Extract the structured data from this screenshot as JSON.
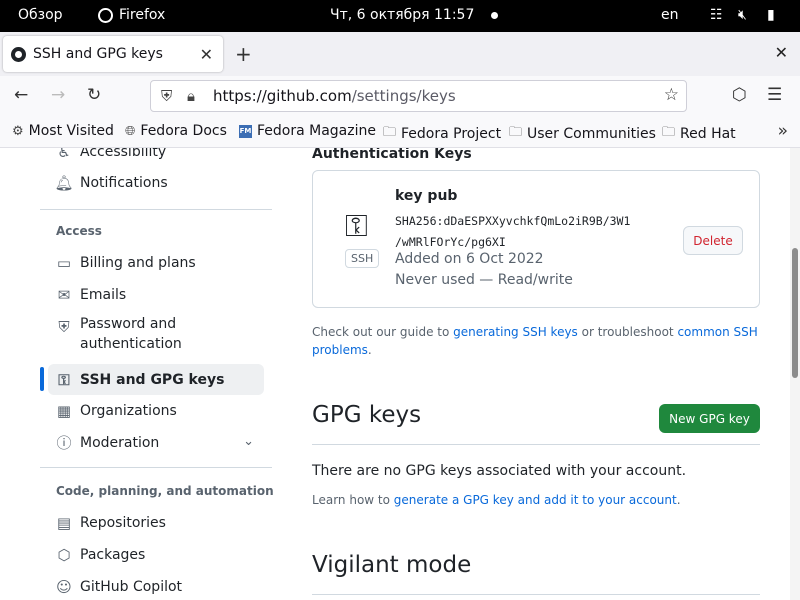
{
  "topbar": {
    "activities": "Обзор",
    "app_name": "Firefox",
    "clock": "Чт, 6 октября  11:57",
    "lang": "en"
  },
  "browser": {
    "tab_title": "SSH and GPG keys",
    "url_host": "https://github.com",
    "url_path": "/settings/keys",
    "bookmarks": [
      "Most Visited",
      "Fedora Docs",
      "Fedora Magazine",
      "Fedora Project",
      "User Communities",
      "Red Hat"
    ]
  },
  "sidebar": {
    "items_top": [
      {
        "label": "Accessibility",
        "icon": "accessibility-icon"
      },
      {
        "label": "Notifications",
        "icon": "bell-icon"
      }
    ],
    "access_heading": "Access",
    "access_items": [
      {
        "label": "Billing and plans",
        "icon": "credit-card-icon"
      },
      {
        "label": "Emails",
        "icon": "mail-icon"
      },
      {
        "label": "Password and\nauthentication",
        "icon": "shield-lock-icon"
      },
      {
        "label": "SSH and GPG keys",
        "icon": "key-icon"
      },
      {
        "label": "Organizations",
        "icon": "organization-icon"
      },
      {
        "label": "Moderation",
        "icon": "report-icon"
      }
    ],
    "code_heading": "Code, planning, and automation",
    "code_items": [
      {
        "label": "Repositories",
        "icon": "repo-icon"
      },
      {
        "label": "Packages",
        "icon": "package-icon"
      },
      {
        "label": "GitHub Copilot",
        "icon": "copilot-icon"
      }
    ]
  },
  "main": {
    "auth_title": "Authentication Keys",
    "key": {
      "name": "key pub",
      "fingerprint_line1": "SHA256:dDaESPXXyvchkfQmLo2iR9B/3W1",
      "fingerprint_line2": "/wMRlFOrYc/pg6XI",
      "badge": "SSH",
      "added": "Added on 6 Oct 2022",
      "usage": "Never used — Read/write",
      "delete_label": "Delete"
    },
    "guide_prefix": "Check out our guide to ",
    "guide_link1": "generating SSH keys",
    "guide_middle": " or troubleshoot ",
    "guide_link2": "common SSH problems",
    "guide_suffix": ".",
    "gpg_title": "GPG keys",
    "new_gpg_label": "New GPG key",
    "no_gpg": "There are no GPG keys associated with your account.",
    "learn_prefix": "Learn how to ",
    "learn_link": "generate a GPG key and add it to your account",
    "learn_suffix": ".",
    "vigilant_title": "Vigilant mode"
  }
}
